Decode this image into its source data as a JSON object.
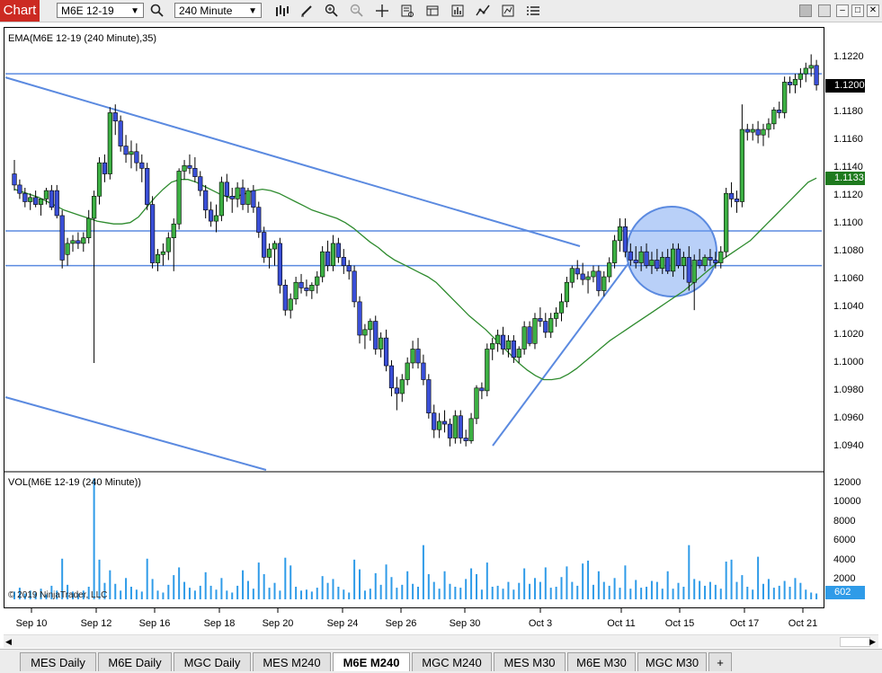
{
  "app": {
    "label": "Chart"
  },
  "toolbar": {
    "instrument": "M6E 12-19",
    "interval": "240 Minute"
  },
  "panels": {
    "price_label": "EMA(M6E 12-19 (240 Minute),35)",
    "volume_label": "VOL(M6E 12-19 (240 Minute))",
    "copyright": "© 2019 NinjaTrader, LLC"
  },
  "price_axis": {
    "ticks": [
      "1.1220",
      "1.1180",
      "1.1160",
      "1.1140",
      "1.1120",
      "1.1100",
      "1.1080",
      "1.1060",
      "1.1040",
      "1.1020",
      "1.1000",
      "1.0980",
      "1.0960",
      "1.0940"
    ],
    "last_price": "1.1200",
    "ema_value": "1.1133"
  },
  "volume_axis": {
    "ticks": [
      "12000",
      "10000",
      "8000",
      "6000",
      "4000",
      "2000"
    ],
    "last_volume": "602"
  },
  "x_axis": {
    "labels": [
      "Sep 10",
      "Sep 12",
      "Sep 16",
      "Sep 18",
      "Sep 20",
      "Sep 24",
      "Sep 26",
      "Sep 30",
      "Oct 3",
      "Oct 11",
      "Oct 15",
      "Oct 17",
      "Oct 21"
    ]
  },
  "tabs": [
    {
      "label": "MES  Daily"
    },
    {
      "label": "M6E  Daily"
    },
    {
      "label": "MGC  Daily"
    },
    {
      "label": "MES  M240"
    },
    {
      "label": "M6E  M240"
    },
    {
      "label": "MGC  M240"
    },
    {
      "label": "MES  M30"
    },
    {
      "label": "M6E  M30"
    },
    {
      "label": "MGC M30"
    },
    {
      "label": "+"
    }
  ],
  "colors": {
    "up": "#3cb043",
    "down": "#3a4fd8",
    "ema": "#2e8b2e",
    "trendline": "#5b8ae0",
    "volume": "#2f9be8",
    "badge_price": "#000000",
    "badge_ema": "#1e7a1e",
    "badge_volume": "#2f9be8",
    "app_label": "#cc2a22"
  },
  "chart_data": {
    "type": "candlestick",
    "instrument": "M6E 12-19",
    "interval": "240 Minute",
    "indicator": "EMA 35",
    "price_range": [
      1.0925,
      1.1232
    ],
    "volume_range": [
      0,
      13000
    ],
    "candles": [
      [
        1.1136,
        1.1146,
        1.1124,
        1.1128
      ],
      [
        1.1128,
        1.1132,
        1.1118,
        1.1122
      ],
      [
        1.1122,
        1.1126,
        1.1112,
        1.1116
      ],
      [
        1.1116,
        1.1122,
        1.111,
        1.1119
      ],
      [
        1.1119,
        1.1124,
        1.1112,
        1.1114
      ],
      [
        1.1114,
        1.1118,
        1.1106,
        1.1118
      ],
      [
        1.1118,
        1.1126,
        1.1114,
        1.1124
      ],
      [
        1.1124,
        1.1128,
        1.111,
        1.1112
      ],
      [
        1.1124,
        1.1128,
        1.1104,
        1.1106
      ],
      [
        1.1106,
        1.111,
        1.1068,
        1.1074
      ],
      [
        1.1078,
        1.109,
        1.107,
        1.1086
      ],
      [
        1.1086,
        1.1092,
        1.108,
        1.1088
      ],
      [
        1.1088,
        1.1094,
        1.1082,
        1.1086
      ],
      [
        1.1086,
        1.1094,
        1.108,
        1.109
      ],
      [
        1.109,
        1.111,
        1.1086,
        1.1104
      ],
      [
        1.1104,
        1.1124,
        1.1,
        1.112
      ],
      [
        1.112,
        1.1148,
        1.1114,
        1.1144
      ],
      [
        1.1144,
        1.115,
        1.113,
        1.1136
      ],
      [
        1.1136,
        1.1184,
        1.1132,
        1.118
      ],
      [
        1.118,
        1.1186,
        1.1164,
        1.1174
      ],
      [
        1.1174,
        1.1178,
        1.1152,
        1.1156
      ],
      [
        1.1156,
        1.1164,
        1.1144,
        1.115
      ],
      [
        1.115,
        1.116,
        1.114,
        1.1152
      ],
      [
        1.1152,
        1.1158,
        1.1138,
        1.1144
      ],
      [
        1.1144,
        1.115,
        1.113,
        1.114
      ],
      [
        1.114,
        1.1144,
        1.111,
        1.1114
      ],
      [
        1.1114,
        1.112,
        1.1068,
        1.1072
      ],
      [
        1.1072,
        1.1082,
        1.1066,
        1.1078
      ],
      [
        1.1078,
        1.1086,
        1.107,
        1.108
      ],
      [
        1.108,
        1.1094,
        1.1074,
        1.109
      ],
      [
        1.109,
        1.1104,
        1.1066,
        1.11
      ],
      [
        1.11,
        1.114,
        1.1096,
        1.1138
      ],
      [
        1.1138,
        1.1146,
        1.1132,
        1.1142
      ],
      [
        1.1142,
        1.115,
        1.1136,
        1.114
      ],
      [
        1.114,
        1.1148,
        1.113,
        1.1134
      ],
      [
        1.1134,
        1.1138,
        1.112,
        1.1124
      ],
      [
        1.1124,
        1.1128,
        1.1104,
        1.111
      ],
      [
        1.111,
        1.1116,
        1.1098,
        1.1102
      ],
      [
        1.1102,
        1.1114,
        1.1094,
        1.1106
      ],
      [
        1.1106,
        1.1134,
        1.1102,
        1.113
      ],
      [
        1.113,
        1.1136,
        1.1116,
        1.112
      ],
      [
        1.112,
        1.1126,
        1.1108,
        1.1118
      ],
      [
        1.1118,
        1.113,
        1.1112,
        1.1126
      ],
      [
        1.1126,
        1.1132,
        1.111,
        1.1114
      ],
      [
        1.1114,
        1.1126,
        1.1108,
        1.1124
      ],
      [
        1.1124,
        1.1128,
        1.1108,
        1.1112
      ],
      [
        1.1112,
        1.1116,
        1.109,
        1.1094
      ],
      [
        1.1094,
        1.1098,
        1.1072,
        1.1076
      ],
      [
        1.1076,
        1.1086,
        1.1068,
        1.1082
      ],
      [
        1.1082,
        1.1088,
        1.107,
        1.1086
      ],
      [
        1.1086,
        1.109,
        1.105,
        1.1056
      ],
      [
        1.1056,
        1.106,
        1.1034,
        1.1038
      ],
      [
        1.1038,
        1.105,
        1.1032,
        1.1046
      ],
      [
        1.1046,
        1.1062,
        1.1042,
        1.1058
      ],
      [
        1.1058,
        1.1064,
        1.105,
        1.1054
      ],
      [
        1.1054,
        1.106,
        1.1048,
        1.1052
      ],
      [
        1.1052,
        1.1058,
        1.1046,
        1.1056
      ],
      [
        1.1056,
        1.1066,
        1.105,
        1.1062
      ],
      [
        1.1062,
        1.1084,
        1.1058,
        1.108
      ],
      [
        1.108,
        1.1088,
        1.1066,
        1.107
      ],
      [
        1.107,
        1.1092,
        1.1066,
        1.1086
      ],
      [
        1.1086,
        1.109,
        1.1072,
        1.1076
      ],
      [
        1.1076,
        1.1082,
        1.1064,
        1.107
      ],
      [
        1.107,
        1.1074,
        1.106,
        1.1066
      ],
      [
        1.1066,
        1.107,
        1.104,
        1.1044
      ],
      [
        1.1044,
        1.1048,
        1.1014,
        1.102
      ],
      [
        1.102,
        1.1028,
        1.101,
        1.1024
      ],
      [
        1.1024,
        1.1032,
        1.1016,
        1.103
      ],
      [
        1.103,
        1.1034,
        1.1006,
        1.101
      ],
      [
        1.101,
        1.1022,
        1.1004,
        1.1018
      ],
      [
        1.1018,
        1.1024,
        1.0994,
        1.0998
      ],
      [
        1.0998,
        1.1002,
        1.0976,
        1.0982
      ],
      [
        1.0982,
        1.099,
        1.0966,
        1.0978
      ],
      [
        1.0978,
        1.0992,
        1.0972,
        1.0988
      ],
      [
        1.0988,
        1.1004,
        1.0984,
        1.1
      ],
      [
        1.1,
        1.1016,
        1.0996,
        1.101
      ],
      [
        1.101,
        1.1018,
        1.0996,
        1.1
      ],
      [
        1.1,
        1.1006,
        1.0984,
        1.0988
      ],
      [
        1.0988,
        1.0992,
        1.096,
        1.0964
      ],
      [
        1.0964,
        1.097,
        1.0946,
        1.0952
      ],
      [
        1.0952,
        1.0964,
        1.0946,
        1.0958
      ],
      [
        1.0958,
        1.0966,
        1.095,
        1.0956
      ],
      [
        1.0956,
        1.096,
        1.094,
        1.0946
      ],
      [
        1.0946,
        1.0966,
        1.0942,
        1.0962
      ],
      [
        1.0962,
        1.0966,
        1.0942,
        1.0946
      ],
      [
        1.0946,
        1.0952,
        1.094,
        1.0944
      ],
      [
        1.0944,
        1.0964,
        1.0942,
        1.096
      ],
      [
        1.096,
        1.0984,
        1.0956,
        1.0982
      ],
      [
        1.0982,
        1.0986,
        1.0974,
        1.098
      ],
      [
        1.098,
        1.1014,
        1.0976,
        1.101
      ],
      [
        1.101,
        1.1018,
        1.1002,
        1.1014
      ],
      [
        1.1014,
        1.1024,
        1.1008,
        1.102
      ],
      [
        1.102,
        1.1026,
        1.1006,
        1.101
      ],
      [
        1.101,
        1.102,
        1.1004,
        1.1016
      ],
      [
        1.1016,
        1.102,
        1.1,
        1.1004
      ],
      [
        1.1004,
        1.1012,
        1.1,
        1.101
      ],
      [
        1.101,
        1.103,
        1.1006,
        1.1026
      ],
      [
        1.1026,
        1.103,
        1.1012,
        1.1014
      ],
      [
        1.1014,
        1.1036,
        1.101,
        1.1032
      ],
      [
        1.1032,
        1.104,
        1.1026,
        1.103
      ],
      [
        1.103,
        1.1036,
        1.1018,
        1.1022
      ],
      [
        1.1022,
        1.1036,
        1.1018,
        1.1032
      ],
      [
        1.1032,
        1.104,
        1.1026,
        1.1036
      ],
      [
        1.1036,
        1.105,
        1.103,
        1.1044
      ],
      [
        1.1044,
        1.1062,
        1.104,
        1.1058
      ],
      [
        1.1058,
        1.107,
        1.1054,
        1.1068
      ],
      [
        1.1068,
        1.1074,
        1.106,
        1.1064
      ],
      [
        1.1064,
        1.1072,
        1.1056,
        1.106
      ],
      [
        1.106,
        1.1066,
        1.105,
        1.1062
      ],
      [
        1.1062,
        1.107,
        1.1058,
        1.1066
      ],
      [
        1.1066,
        1.107,
        1.1048,
        1.1052
      ],
      [
        1.1052,
        1.1066,
        1.1048,
        1.1062
      ],
      [
        1.1062,
        1.1076,
        1.1058,
        1.1072
      ],
      [
        1.1072,
        1.1092,
        1.1068,
        1.1088
      ],
      [
        1.1088,
        1.1104,
        1.108,
        1.1098
      ],
      [
        1.1098,
        1.1104,
        1.1076,
        1.108
      ],
      [
        1.108,
        1.1086,
        1.107,
        1.1074
      ],
      [
        1.1074,
        1.1084,
        1.1068,
        1.1072
      ],
      [
        1.1072,
        1.1084,
        1.1066,
        1.108
      ],
      [
        1.108,
        1.1086,
        1.1068,
        1.107
      ],
      [
        1.107,
        1.108,
        1.1064,
        1.1074
      ],
      [
        1.1074,
        1.1082,
        1.1066,
        1.1068
      ],
      [
        1.1068,
        1.108,
        1.1064,
        1.1076
      ],
      [
        1.1076,
        1.1082,
        1.1064,
        1.1066
      ],
      [
        1.1066,
        1.1086,
        1.1062,
        1.1082
      ],
      [
        1.1082,
        1.1086,
        1.1068,
        1.107
      ],
      [
        1.107,
        1.108,
        1.106,
        1.1076
      ],
      [
        1.1076,
        1.1084,
        1.1052,
        1.1058
      ],
      [
        1.1058,
        1.1078,
        1.1038,
        1.1074
      ],
      [
        1.1074,
        1.1082,
        1.1068,
        1.107
      ],
      [
        1.107,
        1.1078,
        1.1066,
        1.1076
      ],
      [
        1.1076,
        1.1082,
        1.107,
        1.1074
      ],
      [
        1.1074,
        1.108,
        1.1068,
        1.1072
      ],
      [
        1.1072,
        1.1084,
        1.1068,
        1.108
      ],
      [
        1.108,
        1.1126,
        1.1076,
        1.1122
      ],
      [
        1.1122,
        1.113,
        1.1112,
        1.1118
      ],
      [
        1.1118,
        1.1124,
        1.1108,
        1.1116
      ],
      [
        1.1116,
        1.1186,
        1.1112,
        1.1168
      ],
      [
        1.1168,
        1.1172,
        1.116,
        1.1166
      ],
      [
        1.1166,
        1.1172,
        1.116,
        1.1168
      ],
      [
        1.1168,
        1.1174,
        1.1158,
        1.1164
      ],
      [
        1.1164,
        1.1172,
        1.1156,
        1.1168
      ],
      [
        1.1168,
        1.1176,
        1.1162,
        1.1172
      ],
      [
        1.1172,
        1.1184,
        1.1168,
        1.1182
      ],
      [
        1.1182,
        1.1188,
        1.1176,
        1.118
      ],
      [
        1.118,
        1.1206,
        1.1176,
        1.1202
      ],
      [
        1.1202,
        1.1206,
        1.1194,
        1.12
      ],
      [
        1.12,
        1.1208,
        1.1194,
        1.1204
      ],
      [
        1.1204,
        1.1212,
        1.1198,
        1.1208
      ],
      [
        1.1208,
        1.1216,
        1.1202,
        1.1212
      ],
      [
        1.1212,
        1.1222,
        1.1206,
        1.1214
      ],
      [
        1.1214,
        1.1218,
        1.1196,
        1.12
      ]
    ],
    "volume": [
      800,
      1200,
      600,
      900,
      700,
      1100,
      500,
      1400,
      900,
      4200,
      1500,
      800,
      600,
      900,
      1300,
      12500,
      4100,
      1700,
      3000,
      1600,
      900,
      2200,
      1300,
      1000,
      800,
      4200,
      2100,
      900,
      700,
      1500,
      2500,
      3300,
      1800,
      1200,
      900,
      1400,
      2800,
      1400,
      1000,
      2200,
      900,
      700,
      1400,
      3000,
      1900,
      1100,
      3800,
      2600,
      1200,
      1700,
      900,
      4300,
      3500,
      1300,
      900,
      1000,
      800,
      1200,
      2400,
      1700,
      2100,
      1300,
      1000,
      700,
      4100,
      3100,
      900,
      1100,
      2700,
      1500,
      3600,
      2300,
      1200,
      1500,
      2900,
      1600,
      1300,
      5600,
      2600,
      1800,
      1100,
      2900,
      1600,
      1300,
      1200,
      2100,
      3200,
      2600,
      1000,
      3800,
      1300,
      1400,
      1100,
      1800,
      1000,
      1700,
      3200,
      1600,
      2200,
      1800,
      3300,
      1200,
      1300,
      2300,
      3400,
      1800,
      1400,
      3700,
      4000,
      1500,
      2900,
      1800,
      1400,
      2200,
      1200,
      3500,
      1100,
      2000,
      1200,
      1300,
      1900,
      1800,
      1100,
      2900,
      1100,
      1700,
      1300,
      5600,
      2100,
      1900,
      1400,
      1800,
      1500,
      1100,
      3900,
      4100,
      1800,
      2500,
      1300,
      1000,
      4400,
      1600,
      2100,
      1200,
      1400,
      1900,
      1300,
      2200,
      1700,
      1000,
      700,
      602
    ],
    "ema": [
      1.1125,
      1.1123,
      1.1121,
      1.1119,
      1.1116,
      1.1113,
      1.111,
      1.1108,
      1.1106,
      1.1104,
      1.1102,
      1.1101,
      1.11,
      1.11,
      1.1101,
      1.1105,
      1.1112,
      1.1119,
      1.1125,
      1.113,
      1.1132,
      1.1132,
      1.113,
      1.1127,
      1.1124,
      1.1121,
      1.1119,
      1.112,
      1.1122,
      1.1124,
      1.1125,
      1.1124,
      1.1122,
      1.1119,
      1.1116,
      1.1113,
      1.111,
      1.1108,
      1.1106,
      1.1104,
      1.1101,
      1.1097,
      1.1092,
      1.1087,
      1.1083,
      1.1078,
      1.1074,
      1.1071,
      1.1068,
      1.1065,
      1.1062,
      1.1058,
      1.1052,
      1.1046,
      1.104,
      1.1034,
      1.1029,
      1.1024,
      1.1018,
      1.1012,
      1.1006,
      1.1,
      1.0995,
      1.0991,
      1.0988,
      1.0988,
      1.0989,
      1.0992,
      1.0996,
      1.1001,
      1.1006,
      1.1011,
      1.1016,
      1.102,
      1.1024,
      1.1028,
      1.1032,
      1.1036,
      1.104,
      1.1044,
      1.1048,
      1.1052,
      1.1057,
      1.1062,
      1.1067,
      1.1072,
      1.1076,
      1.108,
      1.1084,
      1.1088,
      1.1094,
      1.11,
      1.1106,
      1.1112,
      1.1118,
      1.1124,
      1.113,
      1.1133
    ],
    "horizontal_levels": [
      1.1208,
      1.1095,
      1.107
    ],
    "ema_color": "#2e8b2e"
  }
}
